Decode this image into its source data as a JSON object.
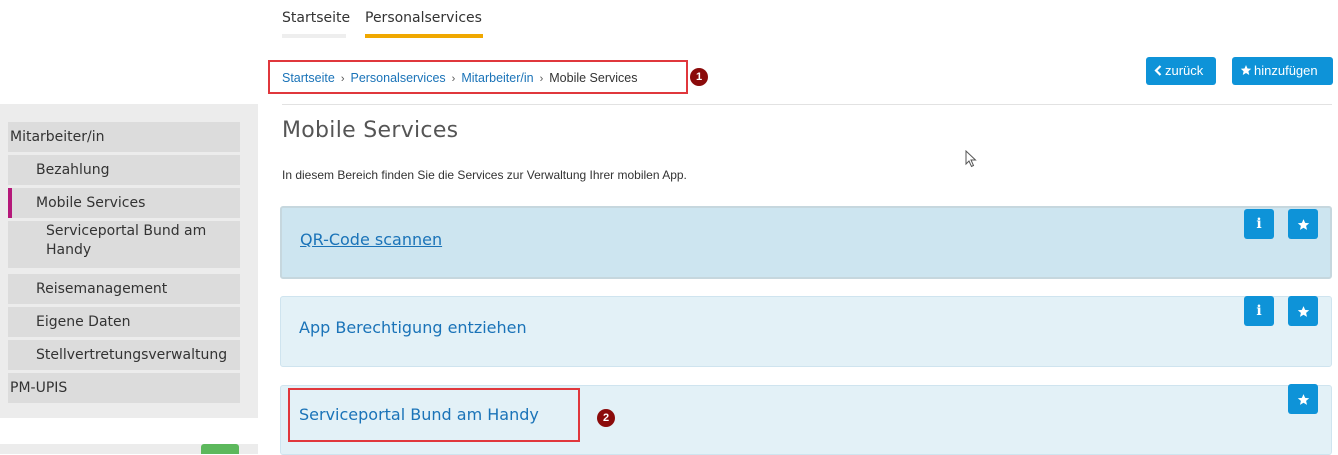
{
  "topnav": {
    "tabs": [
      "Startseite",
      "Personalservices"
    ]
  },
  "breadcrumb": {
    "items": [
      "Startseite",
      "Personalservices",
      "Mitarbeiter/in"
    ],
    "current": "Mobile Services",
    "separator": "›"
  },
  "annotations": {
    "badge1": "1",
    "badge2": "2"
  },
  "actions": {
    "back_label": "zurück",
    "add_label": "hinzufügen"
  },
  "sidebar": {
    "items": [
      "Mitarbeiter/in",
      "Bezahlung",
      "Mobile Services",
      "Serviceportal Bund am Handy",
      "Reisemanagement",
      "Eigene Daten",
      "Stellvertretungsverwaltung",
      "PM-UPIS"
    ]
  },
  "page": {
    "title": "Mobile Services",
    "description": "In diesem Bereich finden Sie die Services zur Verwaltung Ihrer mobilen App."
  },
  "cards": [
    {
      "title": "QR-Code scannen"
    },
    {
      "title": "App Berechtigung entziehen"
    },
    {
      "title": "Serviceportal Bund am Handy"
    }
  ],
  "icons": {
    "back": "chevron-left-icon",
    "add": "star-icon",
    "info": "info-icon",
    "favorite": "star-icon"
  },
  "colors": {
    "accent": "#0e93d8",
    "active_tab": "#f0a800",
    "active_sidebar": "#b5197a",
    "link": "#1a73b8",
    "annotation": "#e0373c"
  }
}
